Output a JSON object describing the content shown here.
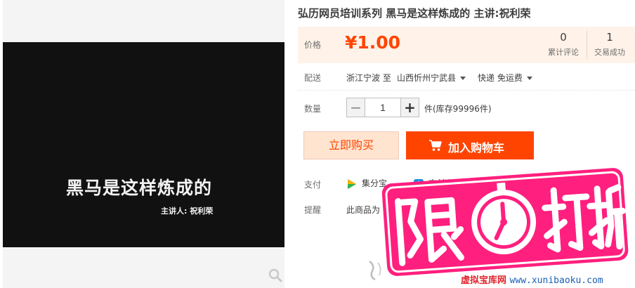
{
  "product": {
    "title": "弘历网员培训系列 黑马是这样炼成的 主讲:祝利荣",
    "image": {
      "title": "黑马是这样炼成的",
      "speaker": "主讲人: 祝利荣",
      "zoom_icon": "magnifier-icon"
    }
  },
  "price": {
    "label": "价格",
    "value": "¥1.00",
    "reviews_count": "0",
    "reviews_label": "累计评论",
    "sold_count": "1",
    "sold_label": "交易成功"
  },
  "shipping": {
    "label": "配送",
    "from": "浙江宁波 至",
    "to": "山西忻州宁武县",
    "method": "快递 免运费"
  },
  "quantity": {
    "label": "数量",
    "minus": "−",
    "value": "1",
    "plus": "+",
    "stock": "件(库存99996件)"
  },
  "actions": {
    "buy_now": "立即购买",
    "add_to_cart": "加入购物车",
    "cart_icon": "cart-icon"
  },
  "payment": {
    "label": "支付",
    "option_1": "集分宝",
    "option_1_icon": "jifenbao-icon",
    "option_2": "支付宝支付",
    "option_2_icon": "alipay-icon"
  },
  "reminder": {
    "label": "提醒",
    "text": "此商品为"
  },
  "promo": {
    "text": "限时打折",
    "icon": "clock-icon"
  },
  "watermark": {
    "cn": "虚拟宝库网",
    "url": "www.xunibaoku.com"
  },
  "colors": {
    "accent": "#ff4400",
    "price_bg": "#fff2e8",
    "promo_pink": "#ff1f7e"
  }
}
